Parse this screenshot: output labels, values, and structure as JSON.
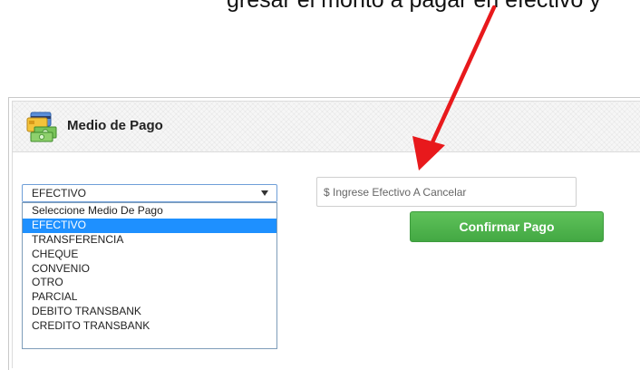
{
  "annotation": {
    "top_text": "gresar el monto a pagar en efectivo y",
    "arrow_color": "#e8191c"
  },
  "panel": {
    "title": "Medio de Pago",
    "icon": "money-cards-icon"
  },
  "payment_method": {
    "selected_value": "EFECTIVO",
    "options": [
      "Seleccione Medio De Pago",
      "EFECTIVO",
      "TRANSFERENCIA",
      "CHEQUE",
      "CONVENIO",
      "OTRO",
      "PARCIAL",
      "DEBITO TRANSBANK",
      "CREDITO TRANSBANK"
    ],
    "highlighted_index": 1
  },
  "amount_input": {
    "placeholder": "$ Ingrese Efectivo A Cancelar",
    "value": ""
  },
  "confirm_button": {
    "label": "Confirmar Pago",
    "color": "#4cae4c"
  }
}
